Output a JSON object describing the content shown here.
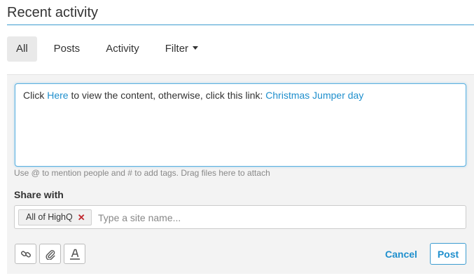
{
  "header": {
    "title": "Recent activity"
  },
  "tabs": [
    {
      "label": "All",
      "active": true
    },
    {
      "label": "Posts",
      "active": false
    },
    {
      "label": "Activity",
      "active": false
    },
    {
      "label": "Filter",
      "active": false,
      "dropdown": true
    }
  ],
  "editor": {
    "text_before": "Click ",
    "link1": "Here",
    "text_middle": " to view the content, otherwise, click this link: ",
    "link2": "Christmas Jumper day",
    "hint": "Use @ to mention people and # to add tags. Drag files here to attach"
  },
  "share": {
    "label": "Share with",
    "tag": "All of HighQ",
    "placeholder": "Type a site name..."
  },
  "toolbar": {
    "icons": [
      "link-icon",
      "paperclip-icon",
      "text-format-icon"
    ],
    "cancel_label": "Cancel",
    "post_label": "Post"
  },
  "colors": {
    "accent": "#1f8fcd",
    "rule": "#3c9cd0",
    "remove": "#c0272d"
  }
}
